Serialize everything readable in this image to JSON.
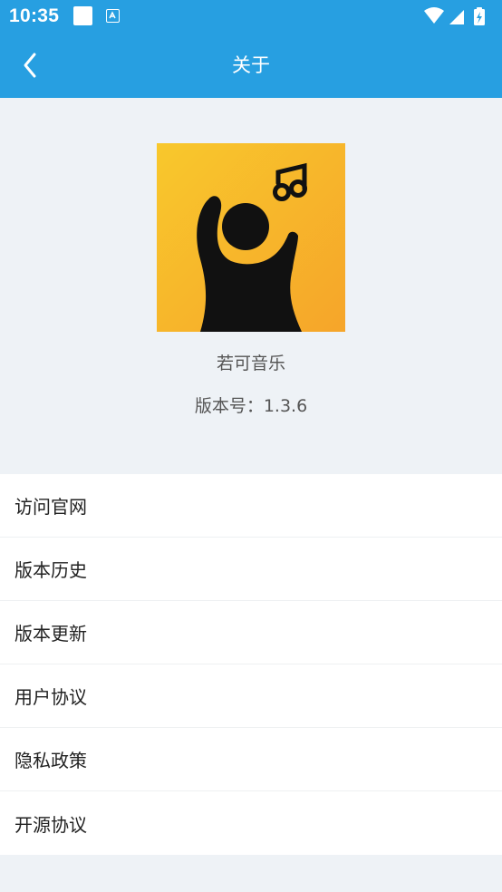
{
  "status_bar": {
    "time": "10:35"
  },
  "app_bar": {
    "title": "关于"
  },
  "about": {
    "app_name": "若可音乐",
    "version": "版本号：1.3.6"
  },
  "menu": [
    {
      "label": "访问官网"
    },
    {
      "label": "版本历史"
    },
    {
      "label": "版本更新"
    },
    {
      "label": "用户协议"
    },
    {
      "label": "隐私政策"
    },
    {
      "label": "开源协议"
    }
  ],
  "colors": {
    "primary": "#279fe1",
    "background": "#eef2f6",
    "logo_yellow": "#f8c12c",
    "logo_orange": "#f6a82a"
  },
  "icons": {
    "back": "chevron-left-icon",
    "wifi": "wifi-icon",
    "signal": "signal-icon",
    "battery": "battery-charging-icon",
    "logo": "music-person-logo"
  }
}
